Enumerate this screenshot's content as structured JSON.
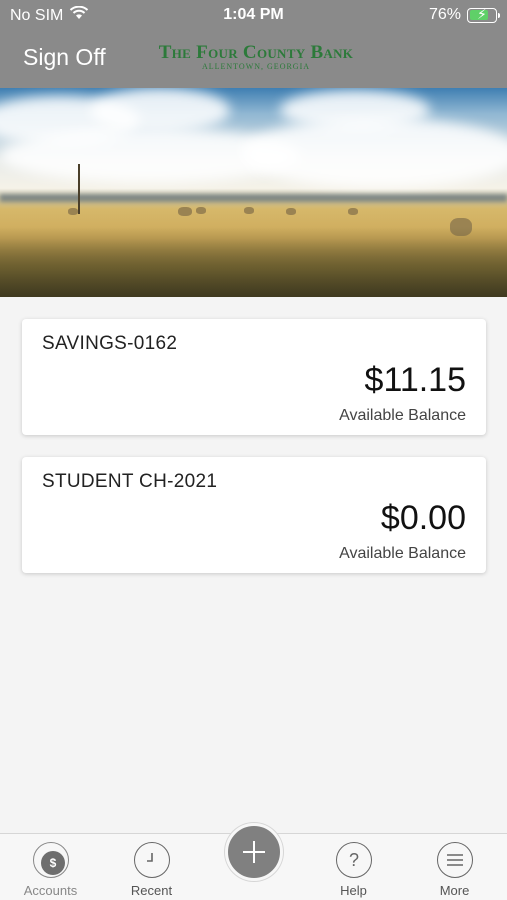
{
  "status": {
    "carrier": "No SIM",
    "time": "1:04 PM",
    "battery": "76%",
    "battery_level": 0.76,
    "battery_color": "#5fd068"
  },
  "header": {
    "sign_off_label": "Sign Off",
    "bank_name": "The Four County Bank",
    "bank_location": "ALLENTOWN, GEORGIA",
    "brand_color": "#2c7a3a",
    "bar_color": "#8a8a8a"
  },
  "accounts": [
    {
      "name": "SAVINGS-0162",
      "amount": "$11.15",
      "label": "Available Balance"
    },
    {
      "name": "STUDENT CH-2021",
      "amount": "$0.00",
      "label": "Available Balance"
    }
  ],
  "tabs": [
    {
      "label": "Accounts",
      "icon": "accounts-icon"
    },
    {
      "label": "Recent",
      "icon": "clock-icon"
    },
    {
      "label": "",
      "icon": "plus-icon"
    },
    {
      "label": "Help",
      "icon": "question-icon"
    },
    {
      "label": "More",
      "icon": "menu-icon"
    }
  ]
}
